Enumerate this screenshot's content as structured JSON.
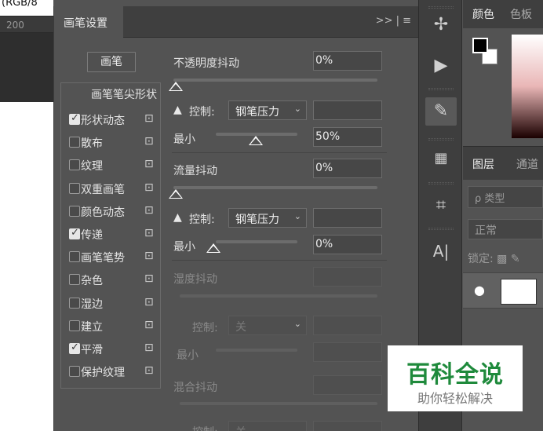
{
  "document": {
    "title_fragment": "(RGB/8",
    "ruler_label": "200"
  },
  "brush_panel": {
    "tab_label": "画笔设置",
    "menu_glyphs": ">> | ≡",
    "brush_button": "画笔",
    "options_header": "画笔笔尖形状",
    "options": [
      {
        "label": "形状动态",
        "checked": true
      },
      {
        "label": "散布",
        "checked": false
      },
      {
        "label": "纹理",
        "checked": false
      },
      {
        "label": "双重画笔",
        "checked": false
      },
      {
        "label": "颜色动态",
        "checked": false
      },
      {
        "label": "传递",
        "checked": true
      },
      {
        "label": "画笔笔势",
        "checked": false
      },
      {
        "label": "杂色",
        "checked": false
      },
      {
        "label": "湿边",
        "checked": false
      },
      {
        "label": "建立",
        "checked": false
      },
      {
        "label": "平滑",
        "checked": true
      },
      {
        "label": "保护纹理",
        "checked": false
      }
    ],
    "opacity_jitter": {
      "label": "不透明度抖动",
      "value": "0%",
      "slider": 0,
      "control_label": "控制:",
      "control_value": "钢笔压力",
      "min_label": "最小",
      "min_value": "50%",
      "min_slider": 0.5
    },
    "flow_jitter": {
      "label": "流量抖动",
      "value": "0%",
      "slider": 0,
      "control_label": "控制:",
      "control_value": "钢笔压力",
      "min_label": "最小",
      "min_value": "0%",
      "min_slider": 0
    },
    "wetness_jitter": {
      "label": "湿度抖动",
      "value": "",
      "control_label": "控制:",
      "control_value": "关",
      "min_label": "最小",
      "min_value": ""
    },
    "mix_jitter": {
      "label": "混合抖动",
      "value": "",
      "control_label": "控制:",
      "control_value": "关"
    }
  },
  "color_panel": {
    "tabs": [
      "颜色",
      "色板"
    ],
    "foreground": "#000000",
    "background": "#ffffff"
  },
  "layers_panel": {
    "tabs": [
      "图层",
      "通道"
    ],
    "search_placeholder": "ρ 类型",
    "blend_mode": "正常",
    "lock_label": "锁定:"
  },
  "watermark": {
    "title": "百科全说",
    "subtitle": "助你轻松解决"
  }
}
